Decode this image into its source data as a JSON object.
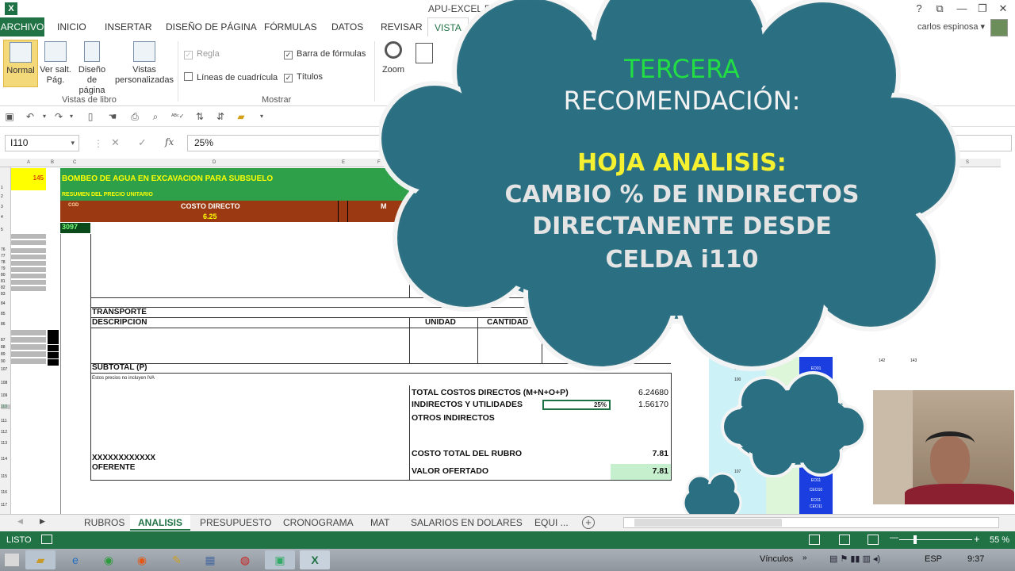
{
  "window": {
    "app_icon": "X",
    "title": "APU-EXCEL EN",
    "help": "?",
    "restore_ribbon": "⧉",
    "minimize": "—",
    "maximize": "❐",
    "close": "✕"
  },
  "ribbon_tabs": [
    "ARCHIVO",
    "INICIO",
    "INSERTAR",
    "DISEÑO DE PÁGINA",
    "FÓRMULAS",
    "DATOS",
    "REVISAR",
    "VISTA"
  ],
  "user": {
    "name": "carlos espinosa ▾"
  },
  "ribbon": {
    "normal": "Normal",
    "ver_salt_1": "Ver salt.",
    "ver_salt_2": "Pág.",
    "diseno_1": "Diseño",
    "diseno_2": "de página",
    "vistas_1": "Vistas",
    "vistas_2": "personalizadas",
    "group_vistas": "Vistas de libro",
    "regla": "Regla",
    "lineas": "Líneas de cuadrícula",
    "barra": "Barra de fórmulas",
    "titulos": "Títulos",
    "group_mostrar": "Mostrar",
    "zoom": "Zoom"
  },
  "formula_bar": {
    "name_box": "I110",
    "name_box_arrow": "▾",
    "cancel": "✕",
    "enter": "✓",
    "fx": "fx",
    "value": "25%"
  },
  "sheet": {
    "col_headers": [
      "A",
      "B",
      "C",
      "D",
      "E",
      "F",
      "S"
    ],
    "cell_a1": "145",
    "title": "BOMBEO DE AGUA EN EXCAVACION PARA SUBSUELO",
    "subtitle": "RESUMEN DEL PRECIO UNITARIO",
    "cod": "COD",
    "costo_directo": "COSTO DIRECTO",
    "costo_directo_value": "6.25",
    "m_label": "M",
    "code": "3097",
    "transporte": "TRANSPORTE",
    "descripcion": "DESCRIPCION",
    "unidad": "UNIDAD",
    "cantidad": "CANTIDAD",
    "subtotal": "SUBTOTAL (P)",
    "nota_iva": "Estos precios no incluyen IVA",
    "xxx": "XXXXXXXXXXXX",
    "oferente": "OFERENTE",
    "total_cd_label": "TOTAL COSTOS DIRECTOS (M+N+O+P)",
    "total_cd_value": "6.24680",
    "indirectos_label": "INDIRECTOS Y UTILIDADES",
    "indirectos_pct": "25%",
    "indirectos_value": "1.56170",
    "otros_label": "OTROS INDIRECTOS",
    "costo_total_label": "COSTO TOTAL DEL RUBRO",
    "costo_total_value": "7.81",
    "valor_label": "VALOR OFERTADO",
    "valor_value": "7.81",
    "blue_labels": [
      "EO01",
      "EO10",
      "EO11",
      "CEO10",
      "EO11",
      "CEO11"
    ],
    "side_numbers": [
      "99",
      "100",
      "107",
      "142",
      "143"
    ]
  },
  "row_numbers": [
    "1",
    "2",
    "3",
    "4",
    "5",
    "76",
    "77",
    "78",
    "79",
    "80",
    "81",
    "82",
    "83",
    "84",
    "85",
    "86",
    "87",
    "88",
    "89",
    "90",
    "107",
    "108",
    "109",
    "110",
    "111",
    "112",
    "113",
    "114",
    "115",
    "116",
    "117"
  ],
  "cloud": {
    "line1": "TERCERA",
    "line2": "RECOMENDACIÓN:",
    "line3": "HOJA ANALISIS:",
    "line4": "CAMBIO % DE INDIRECTOS",
    "line5": "DIRECTANENTE DESDE",
    "line6": "CELDA i110",
    "color_green": "#22dd44",
    "color_yellow": "#f5f030",
    "cloud_fill": "#2b6f82"
  },
  "sheet_tabs": [
    "RUBROS",
    "ANALISIS",
    "PRESUPUESTO",
    "CRONOGRAMA",
    "MAT",
    "SALARIOS EN DOLARES",
    "EQUI ..."
  ],
  "status": {
    "ready": "LISTO",
    "zoom_level": "55 %"
  },
  "taskbar": {
    "vinculos": "Vínculos",
    "lang": "ESP",
    "time": "9:37"
  },
  "colors": {
    "excel_green": "#217346",
    "title_green": "#2ea04a",
    "band_brown": "#9b3a12",
    "blue_col": "#1a3ee0"
  }
}
